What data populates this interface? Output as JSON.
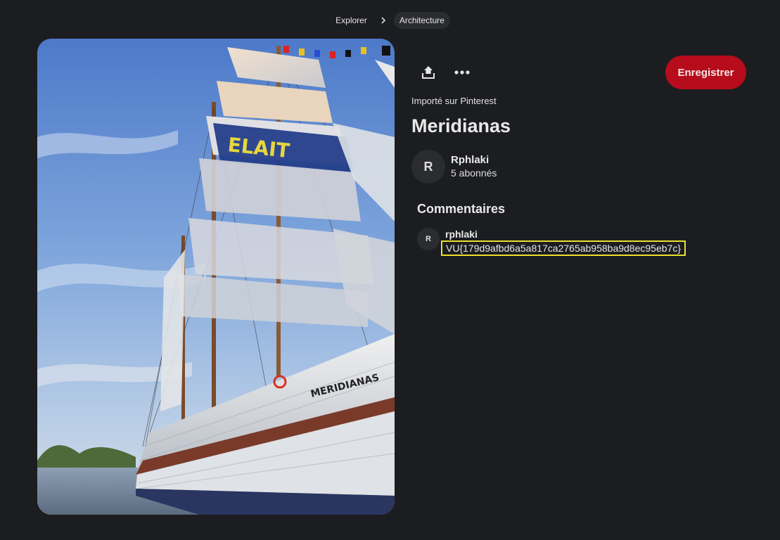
{
  "breadcrumb": {
    "items": [
      "Explorer",
      "Architecture"
    ]
  },
  "toolbar": {
    "share_icon": "share-upload-icon",
    "more_icon": "more-horizontal-icon",
    "save_label": "Enregistrer"
  },
  "pin": {
    "source_text": "Importé sur Pinterest",
    "title": "Meridianas",
    "image_description_icon": "tall-ship-photo"
  },
  "author": {
    "avatar_initial": "R",
    "name": "Rphlaki",
    "followers": "5 abonnés"
  },
  "comments": {
    "heading": "Commentaires",
    "items": [
      {
        "avatar_initial": "R",
        "user": "rphlaki",
        "text": "VU{179d9afbd6a5a817ca2765ab958ba9d8ec95eb7c}"
      }
    ]
  },
  "colors": {
    "background": "#1c1d20",
    "save_button": "#b60c1c",
    "highlight_border": "#e8e030"
  }
}
